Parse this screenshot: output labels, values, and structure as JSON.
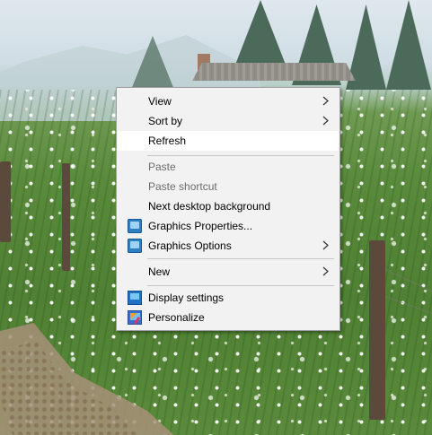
{
  "context_menu": {
    "items": [
      {
        "label": "View",
        "submenu": true,
        "enabled": true
      },
      {
        "label": "Sort by",
        "submenu": true,
        "enabled": true
      },
      {
        "label": "Refresh",
        "submenu": false,
        "enabled": true,
        "highlighted": true
      },
      {
        "label": "Paste",
        "submenu": false,
        "enabled": false
      },
      {
        "label": "Paste shortcut",
        "submenu": false,
        "enabled": false
      },
      {
        "label": "Next desktop background",
        "submenu": false,
        "enabled": true
      },
      {
        "label": "Graphics Properties...",
        "submenu": false,
        "enabled": true,
        "icon": "graphics-properties-icon"
      },
      {
        "label": "Graphics Options",
        "submenu": true,
        "enabled": true,
        "icon": "graphics-options-icon"
      },
      {
        "label": "New",
        "submenu": true,
        "enabled": true
      },
      {
        "label": "Display settings",
        "submenu": false,
        "enabled": true,
        "icon": "display-settings-icon"
      },
      {
        "label": "Personalize",
        "submenu": false,
        "enabled": true,
        "icon": "personalize-icon"
      }
    ]
  },
  "colors": {
    "menu_background": "#f2f2f2",
    "menu_border": "#a0a0a0",
    "highlight": "#ffffff",
    "disabled_text": "#6d6d6d"
  }
}
